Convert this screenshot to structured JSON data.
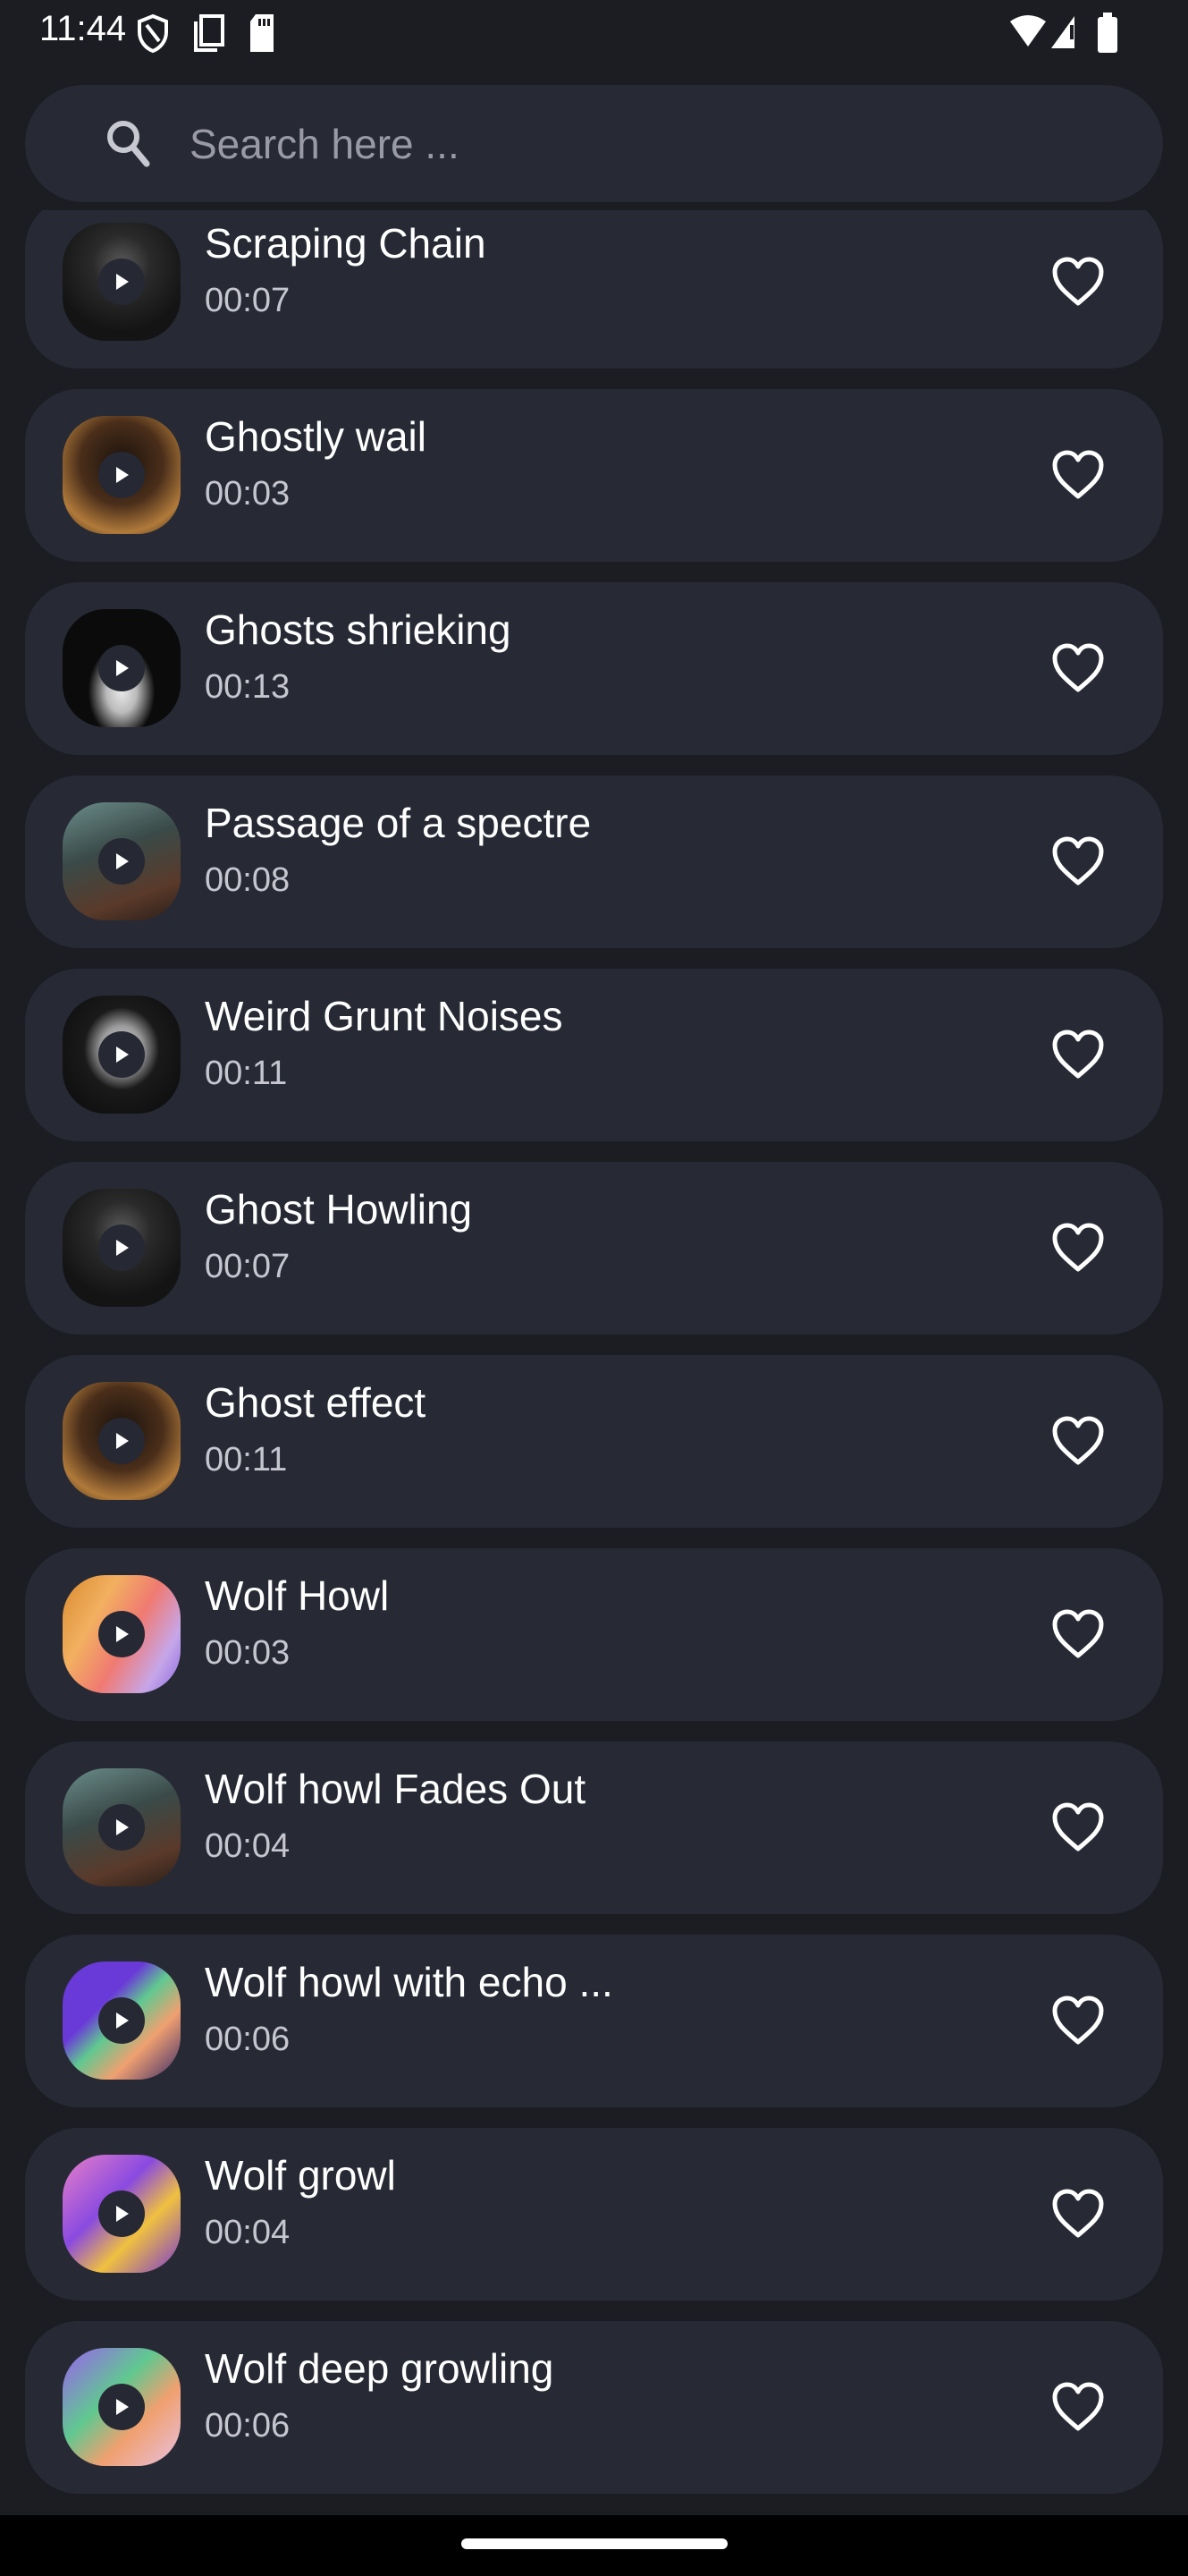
{
  "status_bar": {
    "time": "11:44",
    "left_icons": [
      "shield-icon",
      "copy-icon",
      "sd-card-icon"
    ],
    "right_icons": [
      "wifi-icon",
      "signal-icon",
      "battery-icon"
    ]
  },
  "search": {
    "placeholder": "Search here ...",
    "value": ""
  },
  "colors": {
    "background": "#1b1d23",
    "card": "#272a35",
    "text": "#ffffff",
    "subtext": "#c6c6d0"
  },
  "sounds": [
    {
      "title": "Scraping Chain",
      "duration": "00:07",
      "thumb": "dark-hood"
    },
    {
      "title": "Ghostly wail",
      "duration": "00:03",
      "thumb": "brown"
    },
    {
      "title": "Ghosts shrieking",
      "duration": "00:13",
      "thumb": "nun"
    },
    {
      "title": "Passage of a spectre",
      "duration": "00:08",
      "thumb": "teal"
    },
    {
      "title": "Weird Grunt Noises",
      "duration": "00:11",
      "thumb": "nun-bw"
    },
    {
      "title": "Ghost Howling",
      "duration": "00:07",
      "thumb": "dark-hood"
    },
    {
      "title": "Ghost effect",
      "duration": "00:11",
      "thumb": "brown"
    },
    {
      "title": "Wolf Howl",
      "duration": "00:03",
      "thumb": "orange-purple"
    },
    {
      "title": "Wolf howl Fades Out",
      "duration": "00:04",
      "thumb": "teal"
    },
    {
      "title": "Wolf howl with echo ...",
      "duration": "00:06",
      "thumb": "purple-green"
    },
    {
      "title": "Wolf growl",
      "duration": "00:04",
      "thumb": "purple-yellow"
    },
    {
      "title": "Wolf deep growling",
      "duration": "00:06",
      "thumb": "green-purple"
    }
  ]
}
